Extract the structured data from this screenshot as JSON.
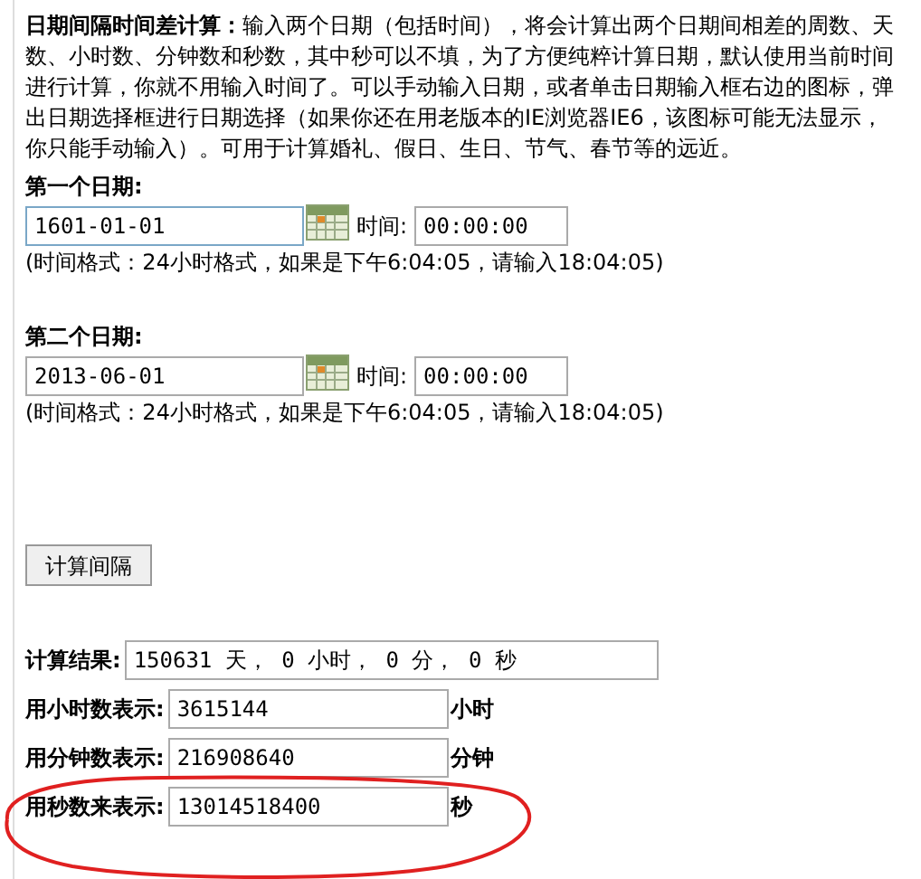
{
  "intro": "**日期间隔时间差计算：**输入两个日期（包括时间），将会计算出两个日期间相差的周数、天数、小时数、分钟数和秒数，其中秒可以不填，为了方便纯粹计算日期，默认使用当前时间进行计算，你就不用输入时间了。可以手动输入日期，或者单击日期输入框右边的图标，弹出日期选择框进行日期选择（如果你还在用老版本的IE浏览器IE6，该图标可能无法显示，你只能手动输入）。可用于计算婚礼、假日、生日、节气、春节等的远近。",
  "dates": [
    {
      "heading": "第一个日期:",
      "date": "1601-01-01",
      "focused": true,
      "time_label": "时间:",
      "time": "00:00:00",
      "hint": "(时间格式：24小时格式，如果是下午6:04:05，请输入18:04:05)"
    },
    {
      "heading": "第二个日期:",
      "date": "2013-06-01",
      "focused": false,
      "time_label": "时间:",
      "time": "00:00:00",
      "hint": "(时间格式：24小时格式，如果是下午6:04:05，请输入18:04:05)"
    }
  ],
  "button": "计算间隔",
  "result": {
    "label": "计算结果:",
    "value": "150631 天， 0 小时， 0 分， 0 秒"
  },
  "conversions": [
    {
      "label": "用小时数表示:",
      "value": "3615144",
      "unit": "小时",
      "circled": false
    },
    {
      "label": "用分钟数表示:",
      "value": "216908640",
      "unit": "分钟",
      "circled": false
    },
    {
      "label": "用秒数来表示:",
      "value": "13014518400",
      "unit": "秒",
      "circled": true
    }
  ]
}
